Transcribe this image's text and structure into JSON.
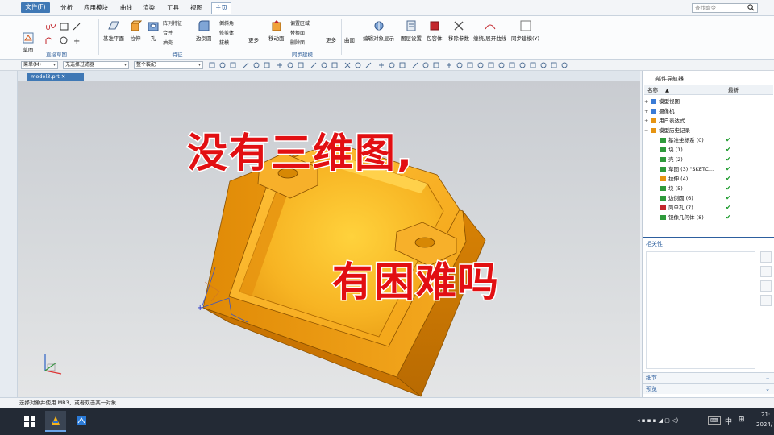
{
  "menu": {
    "file": "文件(F)",
    "items": [
      "分析",
      "应用模块",
      "曲线",
      "渲染",
      "工具",
      "视图"
    ],
    "home": "主页",
    "search_placeholder": "查找命令"
  },
  "ribbon": {
    "sketch": "草图",
    "direct_sketch_group": "直接草图",
    "datum_plane": "基准平面",
    "extrude": "拉伸",
    "hole": "孔",
    "pattern_feature": "阵列特征",
    "unite": "合并",
    "shell": "抽壳",
    "edge_blend": "边倒圆",
    "chamfer": "倒斜角",
    "trim_body": "修剪体",
    "draft": "拔模",
    "more1": "更多",
    "feature_group": "特征",
    "move_face": "移动面",
    "offset_region": "偏置区域",
    "replace_face": "替换面",
    "delete_face": "删除面",
    "more2": "更多",
    "sync_group": "同步建模",
    "surface": "曲面",
    "edit_object_display": "编辑对象显示",
    "layer_settings": "图层设置",
    "wrap": "包容体",
    "remove_params": "移除参数",
    "unwrap_curve": "缠绕/展开曲线",
    "sync_modeling": "同步建模(Y)"
  },
  "toolbar2": {
    "menu": "菜单(M)",
    "filter": "无选择过滤器",
    "assembly": "整个装配"
  },
  "document": {
    "tab": "model3.prt"
  },
  "overlay": {
    "line1": "没有三维图,",
    "line2": "有困难吗"
  },
  "navigator": {
    "title": "部件导航器",
    "col_name": "名称",
    "col_latest": "最新",
    "items": [
      {
        "label": "模型视图",
        "check": ""
      },
      {
        "label": "摄像机",
        "check": ""
      },
      {
        "label": "用户表达式",
        "check": ""
      },
      {
        "label": "模型历史记录",
        "check": ""
      },
      {
        "label": "基准坐标系 (0)",
        "check": "✔"
      },
      {
        "label": "块 (1)",
        "check": "✔"
      },
      {
        "label": "壳 (2)",
        "check": "✔"
      },
      {
        "label": "草图 (3) \"SKETC...",
        "check": "✔"
      },
      {
        "label": "拉伸 (4)",
        "check": "✔"
      },
      {
        "label": "块 (5)",
        "check": "✔"
      },
      {
        "label": "边倒圆 (6)",
        "check": "✔"
      },
      {
        "label": "简单孔 (7)",
        "check": "✔"
      },
      {
        "label": "镜像几何体 (8)",
        "check": "✔"
      }
    ],
    "relevance": "相关性",
    "details": "细节",
    "preview": "预览"
  },
  "status": {
    "text": "选择对象并使用 MB3，或者双击某一对象"
  },
  "taskbar": {
    "lang": "中",
    "time": "21:",
    "date": "2024/"
  }
}
